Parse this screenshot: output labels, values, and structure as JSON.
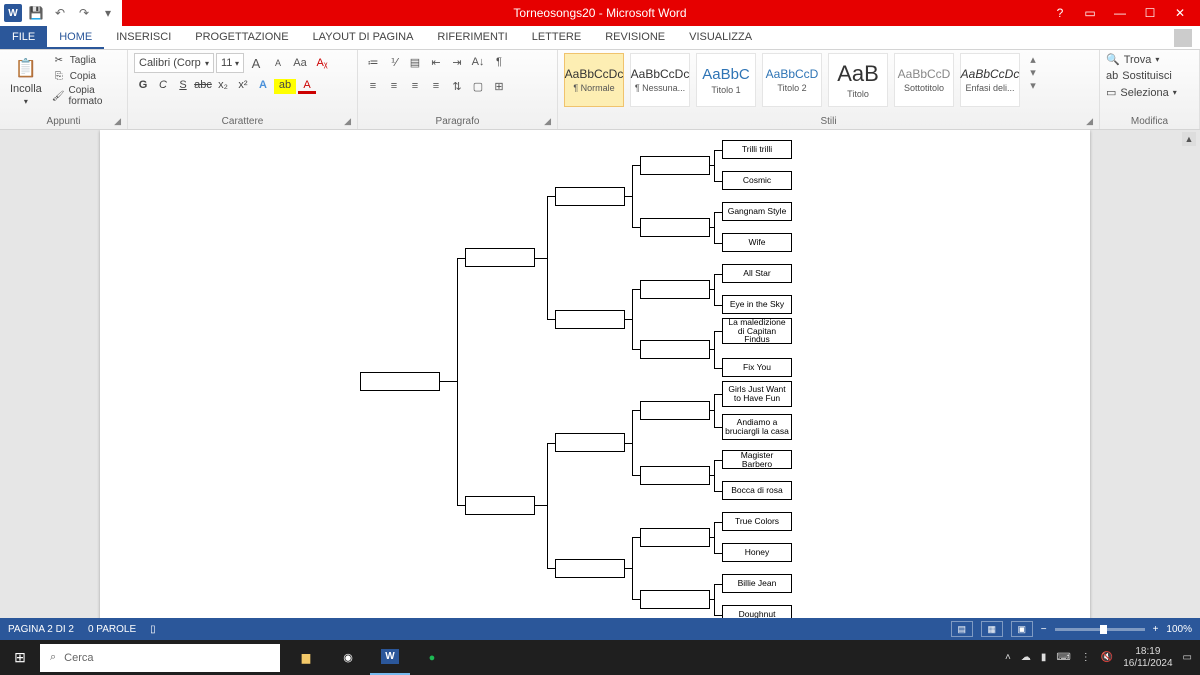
{
  "title": "Torneosongs20 - Microsoft Word",
  "qat": {
    "undo": "↶",
    "redo": "↷",
    "save": "💾"
  },
  "tabs": {
    "file": "FILE",
    "home": "HOME",
    "inserisci": "INSERISCI",
    "progettazione": "PROGETTAZIONE",
    "layout": "LAYOUT DI PAGINA",
    "riferimenti": "RIFERIMENTI",
    "lettere": "LETTERE",
    "revisione": "REVISIONE",
    "visualizza": "VISUALIZZA"
  },
  "clipboard": {
    "incolla": "Incolla",
    "taglia": "Taglia",
    "copia": "Copia",
    "copiaformato": "Copia formato",
    "label": "Appunti"
  },
  "font": {
    "name": "Calibri (Corp",
    "size": "11",
    "label": "Carattere",
    "grow": "A",
    "shrink": "A",
    "case": "Aa",
    "clear": "✕",
    "b": "G",
    "i": "C",
    "u": "S",
    "strike": "abc",
    "sub": "x₂",
    "sup": "x²",
    "effects": "A",
    "hl": "ab",
    "color": "A"
  },
  "para": {
    "label": "Paragrafo"
  },
  "styles": {
    "label": "Stili",
    "list": [
      {
        "sample": "AaBbCcDc",
        "name": "¶ Normale",
        "sel": true
      },
      {
        "sample": "AaBbCcDc",
        "name": "¶ Nessuna..."
      },
      {
        "sample": "AaBbC",
        "name": "Titolo 1",
        "big": true,
        "blue": true
      },
      {
        "sample": "AaBbCcD",
        "name": "Titolo 2",
        "blue": true
      },
      {
        "sample": "AaB",
        "name": "Titolo",
        "huge": true
      },
      {
        "sample": "AaBbCcD",
        "name": "Sottotitolo",
        "gray": true
      },
      {
        "sample": "AaBbCcDc",
        "name": "Enfasi deli...",
        "ital": true
      }
    ]
  },
  "edit": {
    "label": "Modifica",
    "trova": "Trova",
    "sostituisci": "Sostituisci",
    "seleziona": "Seleziona"
  },
  "bracket": {
    "r16": [
      "Trilli trilli",
      "Cosmic",
      "Gangnam Style",
      "Wife",
      "All Star",
      "Eye in the Sky",
      "La maledizione di Capitan Findus",
      "Fix You",
      "Girls Just Want to Have Fun",
      "Andiamo a bruciargli la casa",
      "Magister Barbero",
      "Bocca di rosa",
      "True Colors",
      "Honey",
      "Billie Jean",
      "Doughnut"
    ]
  },
  "status": {
    "page": "PAGINA 2 DI 2",
    "words": "0 PAROLE",
    "zoom": "100%"
  },
  "taskbar": {
    "search": "Cerca",
    "time": "18:19",
    "date": "16/11/2024"
  }
}
